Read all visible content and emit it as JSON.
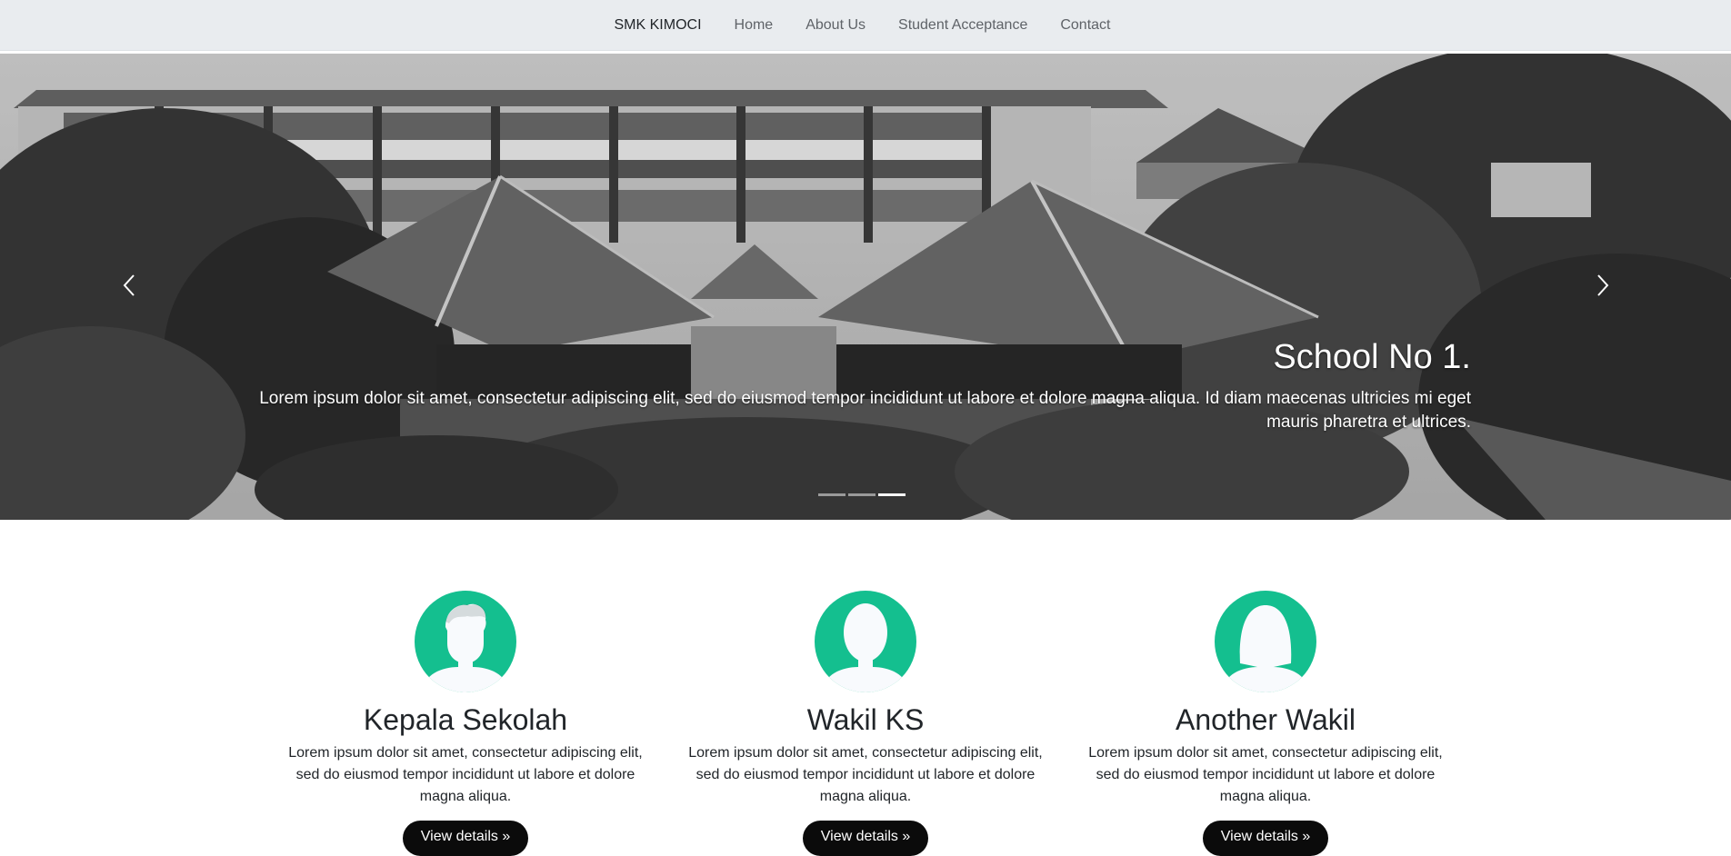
{
  "navbar": {
    "brand": "SMK KIMOCI",
    "links": [
      "Home",
      "About Us",
      "Student Acceptance",
      "Contact"
    ]
  },
  "carousel": {
    "title": "School No 1.",
    "text": "Lorem ipsum dolor sit amet, consectetur adipiscing elit, sed do eiusmod tempor incididunt ut labore et dolore magna aliqua. Id diam maecenas ultricies mi eget mauris pharetra et ultrices.",
    "slide_count": 3,
    "active_slide": 3,
    "prev_icon": "chevron-left-icon",
    "next_icon": "chevron-right-icon"
  },
  "staff": [
    {
      "name": "Kepala Sekolah",
      "text": "Lorem ipsum dolor sit amet, consectetur adipiscing elit, sed do eiusmod tempor incididunt ut labore et dolore magna aliqua.",
      "button": "View details »",
      "avatar_icon": "male-avatar-icon"
    },
    {
      "name": "Wakil KS",
      "text": "Lorem ipsum dolor sit amet, consectetur adipiscing elit, sed do eiusmod tempor incididunt ut labore et dolore magna aliqua.",
      "button": "View details »",
      "avatar_icon": "female-avatar-icon"
    },
    {
      "name": "Another Wakil",
      "text": "Lorem ipsum dolor sit amet, consectetur adipiscing elit, sed do eiusmod tempor incididunt ut labore et dolore magna aliqua.",
      "button": "View details »",
      "avatar_icon": "female-avatar-icon"
    }
  ],
  "colors": {
    "navbar_bg": "#e9ecef",
    "avatar_accent": "#14bf8f",
    "button_bg": "#0b0b0b"
  }
}
